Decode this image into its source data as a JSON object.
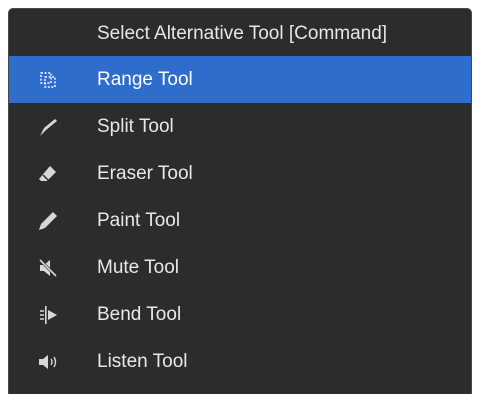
{
  "menu": {
    "header": "Select Alternative Tool [Command]",
    "items": [
      {
        "label": "Range Tool",
        "icon": "range-tool-icon",
        "selected": true
      },
      {
        "label": "Split Tool",
        "icon": "split-tool-icon",
        "selected": false
      },
      {
        "label": "Eraser Tool",
        "icon": "eraser-tool-icon",
        "selected": false
      },
      {
        "label": "Paint Tool",
        "icon": "paint-tool-icon",
        "selected": false
      },
      {
        "label": "Mute Tool",
        "icon": "mute-tool-icon",
        "selected": false
      },
      {
        "label": "Bend Tool",
        "icon": "bend-tool-icon",
        "selected": false
      },
      {
        "label": "Listen Tool",
        "icon": "listen-tool-icon",
        "selected": false
      }
    ]
  },
  "colors": {
    "background": "#2b2d2d",
    "selected": "#2f6dcc",
    "text": "#e8e8e8"
  }
}
